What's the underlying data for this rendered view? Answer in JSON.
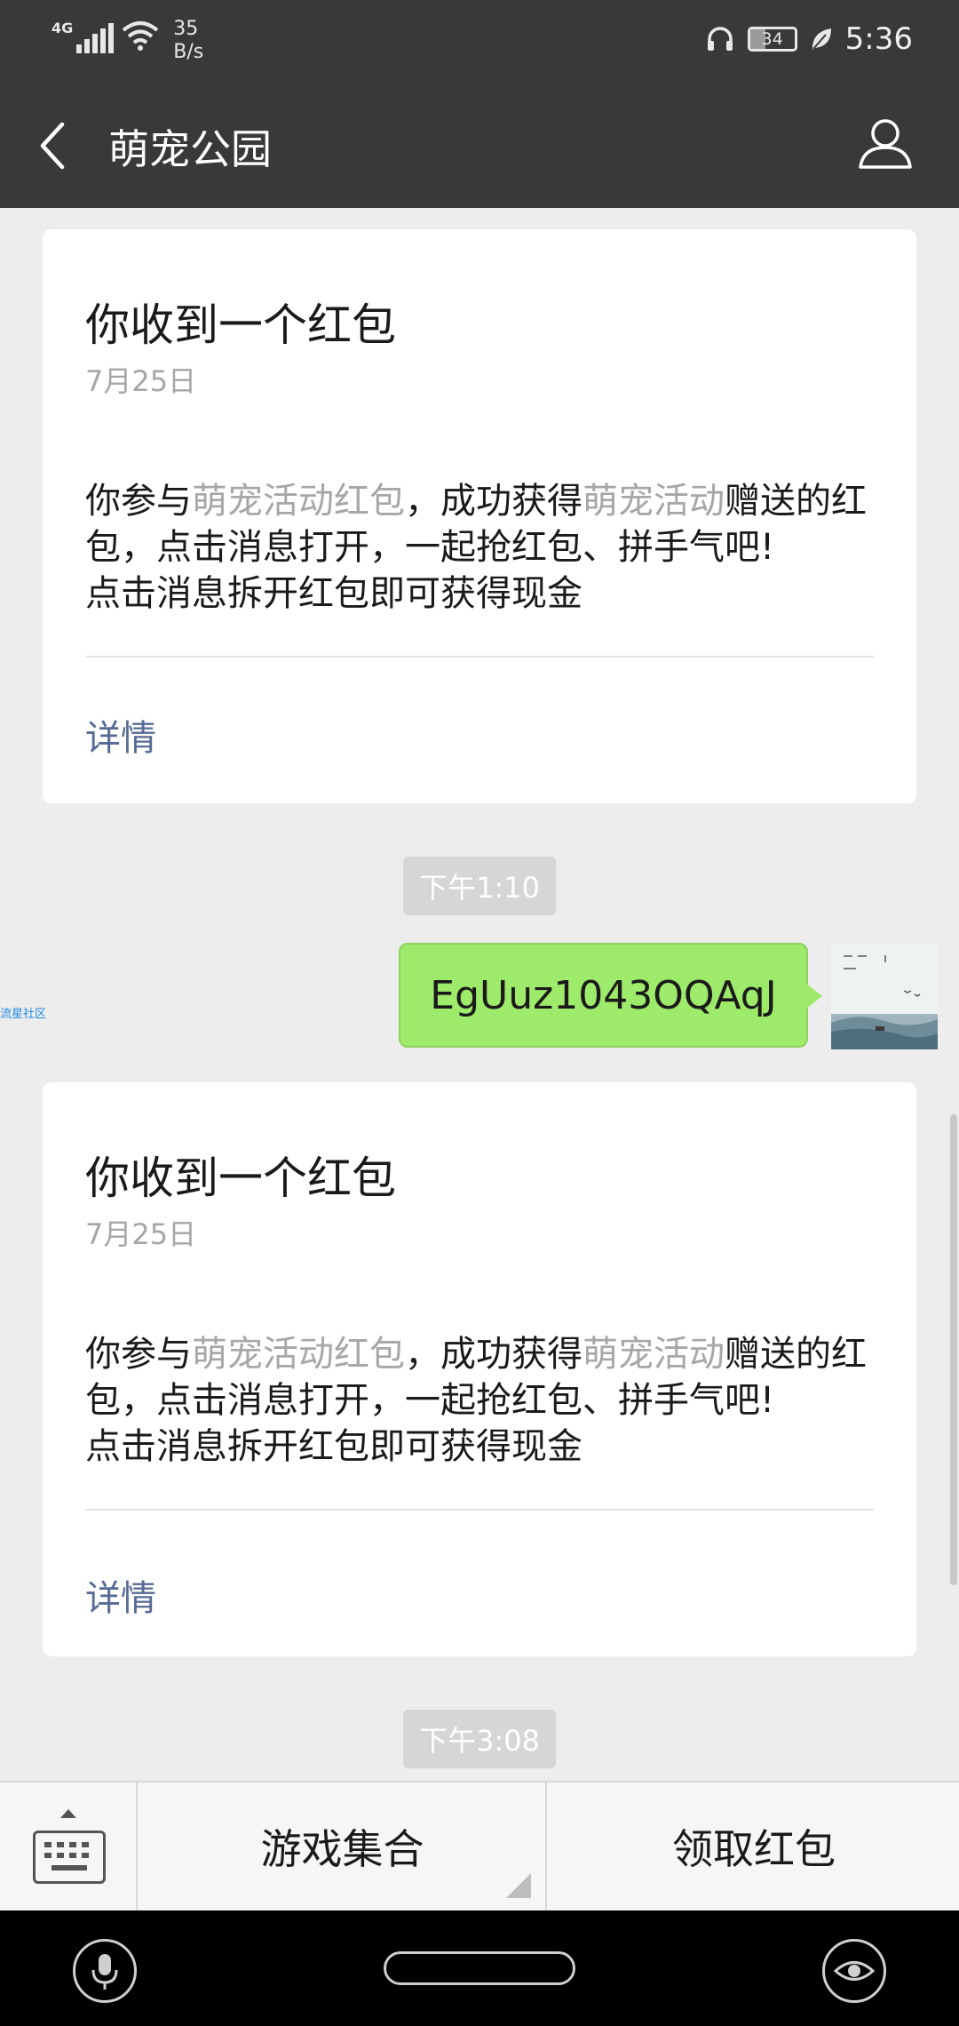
{
  "status_bar": {
    "network": "4G",
    "speed_value": "35",
    "speed_unit": "B/s",
    "battery": "34",
    "time": "5:36"
  },
  "nav": {
    "title": "萌宠公园"
  },
  "cards": [
    {
      "title": "你收到一个红包",
      "date": "7月25日",
      "body_1": "你参与",
      "body_hl_1": "萌宠活动红包",
      "body_2": "，成功获得",
      "body_hl_2": "萌宠活动",
      "body_3": "赠送的红包，点击消息打开，一起抢红包、拼手气吧!",
      "body_4": "点击消息拆开红包即可获得现金",
      "link": "详情"
    },
    {
      "title": "你收到一个红包",
      "date": "7月25日",
      "body_1": "你参与",
      "body_hl_1": "萌宠活动红包",
      "body_2": "，成功获得",
      "body_hl_2": "萌宠活动",
      "body_3": "赠送的红包，点击消息打开，一起抢红包、拼手气吧!",
      "body_4": "点击消息拆开红包即可获得现金",
      "link": "详情"
    }
  ],
  "timestamps": [
    "下午1:10",
    "下午3:08"
  ],
  "message": {
    "text": "EgUuz1043OQAqJ"
  },
  "side_tag": "流星社区",
  "menu": {
    "item_1": "游戏集合",
    "item_2": "领取红包"
  },
  "colors": {
    "header_bg": "#393939",
    "chat_bg": "#ededed",
    "bubble_green": "#9eea6a",
    "link_blue": "#576b95"
  }
}
